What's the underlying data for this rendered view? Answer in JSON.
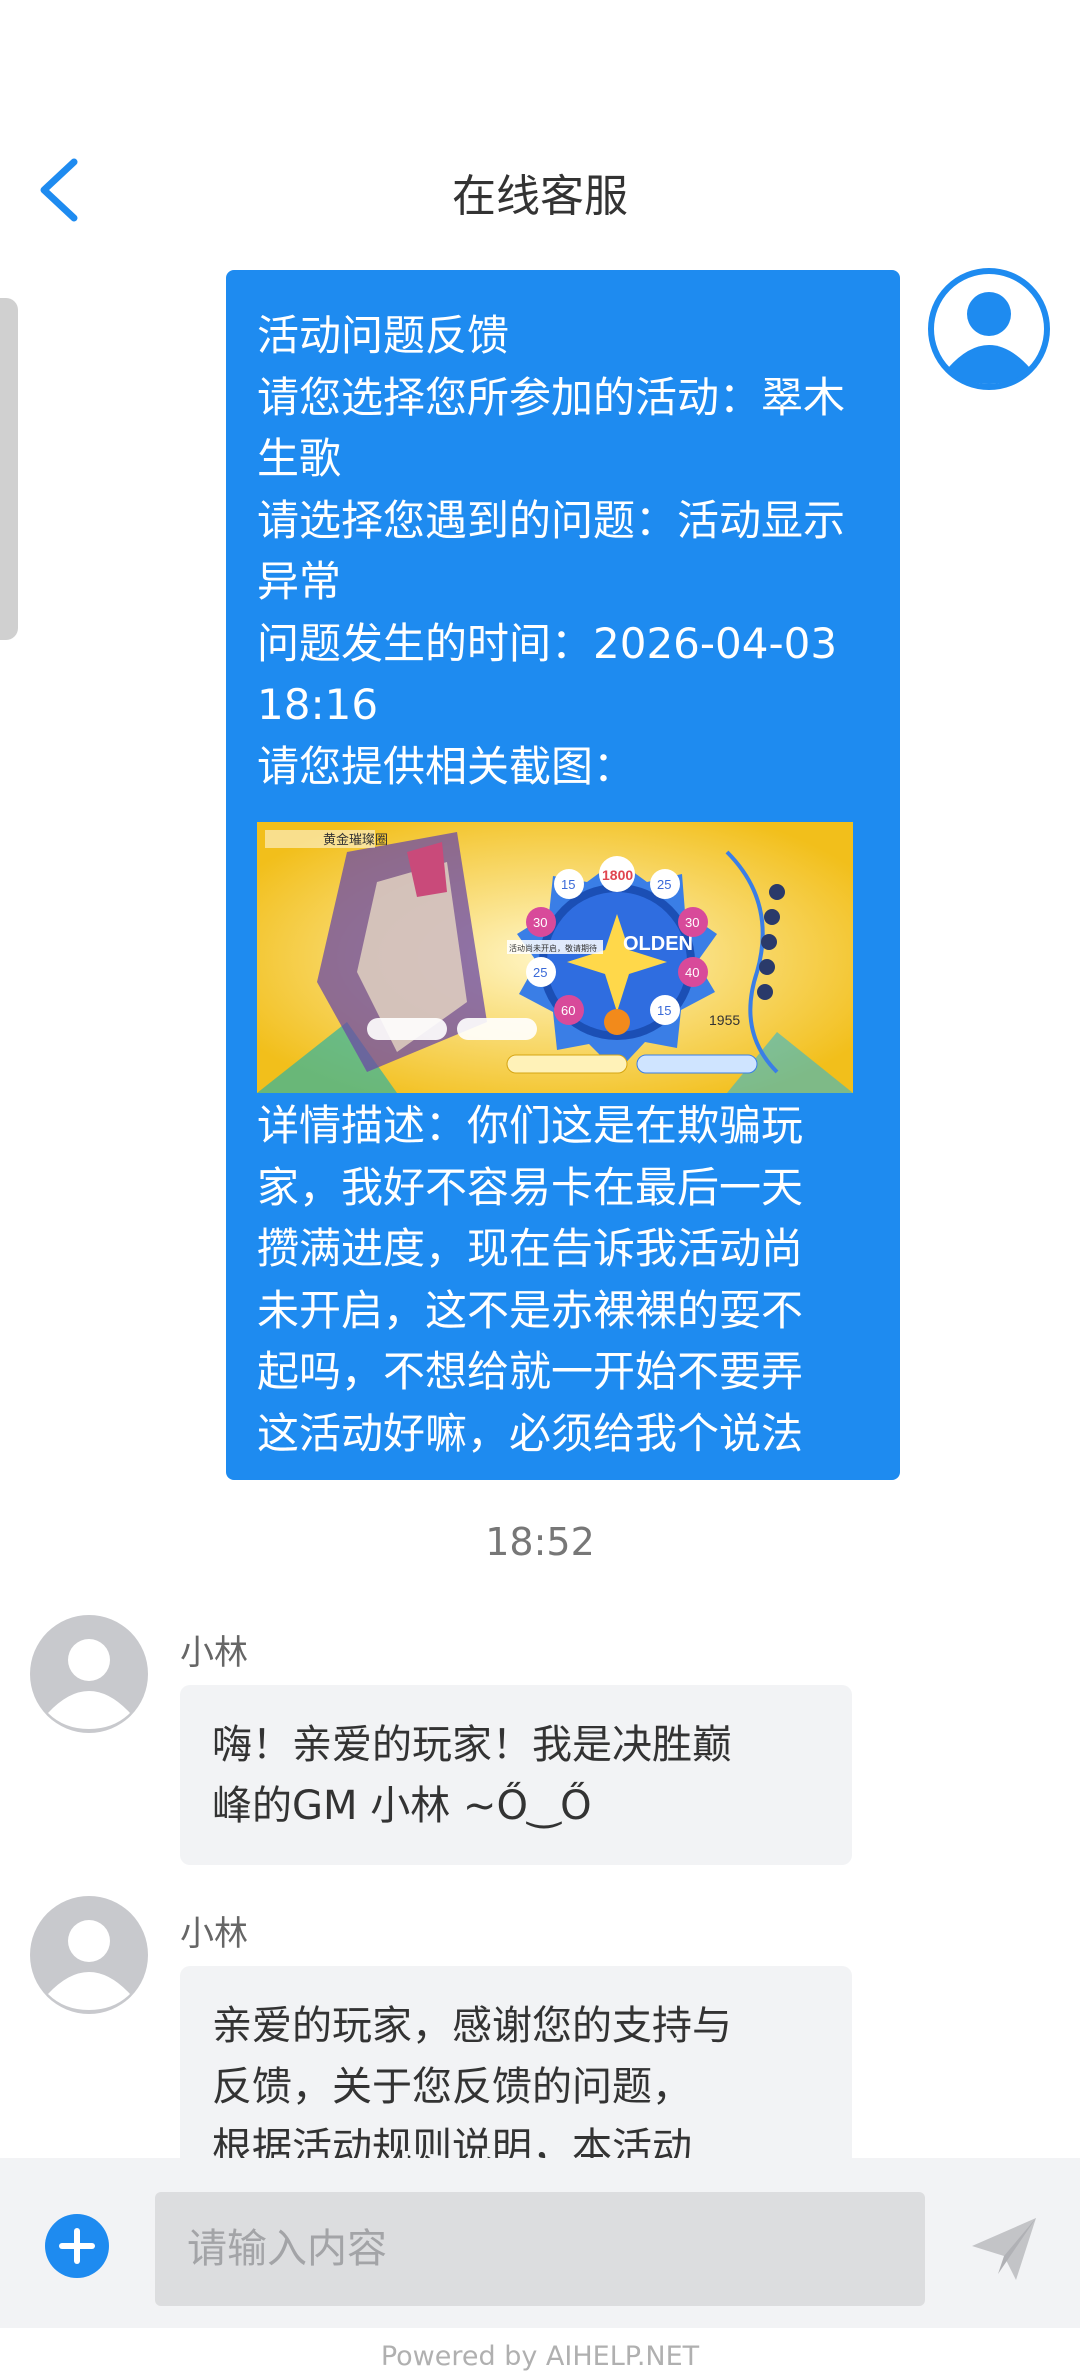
{
  "header": {
    "title": "在线客服"
  },
  "user_message": {
    "lines": [
      "活动问题反馈",
      "请您选择您所参加的活动：翠木",
      "生歌",
      "请选择您遇到的问题：活动显示",
      "异常",
      "问题发生的时间：2026-04-03",
      "18:16",
      "请您提供相关截图："
    ],
    "screenshot": {
      "title": "黄金璀璨圈",
      "logo_text": "OLDEN",
      "center_value": "1800",
      "ring_values": [
        "15",
        "25",
        "30",
        "30",
        "25",
        "40",
        "60",
        "15"
      ],
      "right_value": "1955",
      "notice": "活动尚未开启，敬请期待"
    },
    "desc_lines": [
      "详情描述：你们这是在欺骗玩",
      "家，我好不容易卡在最后一天",
      "攒满进度，现在告诉我活动尚",
      "未开启，这不是赤裸裸的耍不",
      "起吗，不想给就一开始不要弄",
      "这活动好嘛，必须给我个说法"
    ]
  },
  "timestamp": "18:52",
  "agent_messages": [
    {
      "name": "小林",
      "lines": [
        "嗨！亲爱的玩家！我是决胜巅",
        "峰的GM 小林 ~Ő‿Ő"
      ]
    },
    {
      "name": "小林",
      "lines": [
        "亲爱的玩家，感谢您的支持与",
        "反馈，关于您反馈的问题，",
        "根据活动规则说明，本活动"
      ]
    }
  ],
  "input": {
    "placeholder": "请输入内容"
  },
  "footer": {
    "powered": "Powered by AIHELP.NET"
  },
  "icons": {
    "back": "chevron-left-icon",
    "avatar": "user-icon",
    "add": "plus-circle-icon",
    "send": "paper-plane-icon"
  },
  "colors": {
    "accent": "#1e8bf0",
    "user_bubble": "#1e8bf0",
    "agent_bubble": "#f2f3f5",
    "avatar_gray": "#c8c9cd",
    "input_bar": "#f2f3f5"
  }
}
